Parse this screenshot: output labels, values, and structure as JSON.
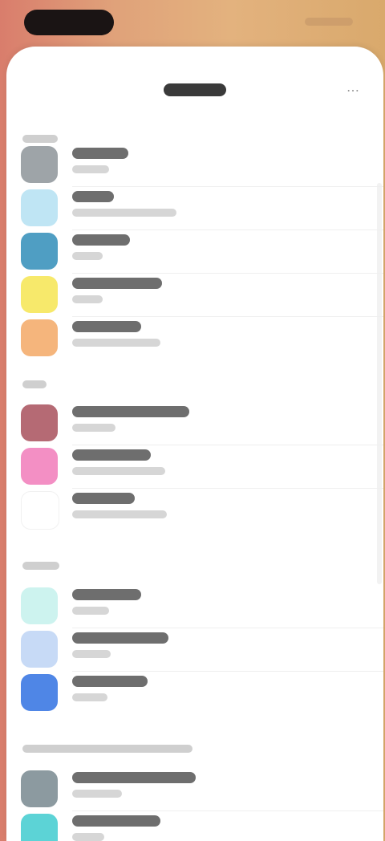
{
  "status_bar": {
    "left": "",
    "right": ""
  },
  "header": {
    "title": "",
    "action_icon": "more-icon"
  },
  "groups": [
    {
      "label": "",
      "items": [
        {
          "name": "sidebar-item-1",
          "color": "#9ea4a8",
          "title": "",
          "subtitle": ""
        },
        {
          "name": "sidebar-item-2",
          "color": "#bfe5f4",
          "title": "",
          "subtitle": ""
        },
        {
          "name": "sidebar-item-3",
          "color": "#4f9ec3",
          "title": "",
          "subtitle": ""
        },
        {
          "name": "sidebar-item-4",
          "color": "#f7e96b",
          "title": "",
          "subtitle": ""
        },
        {
          "name": "sidebar-item-5",
          "color": "#f5b57c",
          "title": "",
          "subtitle": ""
        }
      ]
    },
    {
      "label": "",
      "items": [
        {
          "name": "sidebar-item-6",
          "color": "#b56a74",
          "title": "",
          "subtitle": ""
        },
        {
          "name": "sidebar-item-7",
          "color": "#f38fc4",
          "title": "",
          "subtitle": ""
        },
        {
          "name": "sidebar-item-8",
          "color": "#ffffff",
          "title": "",
          "subtitle": ""
        }
      ]
    },
    {
      "label": "",
      "items": [
        {
          "name": "sidebar-item-9",
          "color": "#cdf3ef",
          "title": "",
          "subtitle": ""
        },
        {
          "name": "sidebar-item-10",
          "color": "#c7daf6",
          "title": "",
          "subtitle": ""
        },
        {
          "name": "sidebar-item-11",
          "color": "#4f86e6",
          "title": "",
          "subtitle": ""
        }
      ]
    },
    {
      "label": "",
      "items": [
        {
          "name": "sidebar-item-12",
          "color": "#8c9aa0",
          "title": "",
          "subtitle": ""
        },
        {
          "name": "sidebar-item-13",
          "color": "#5cd3d6",
          "title": "",
          "subtitle": ""
        }
      ]
    }
  ]
}
